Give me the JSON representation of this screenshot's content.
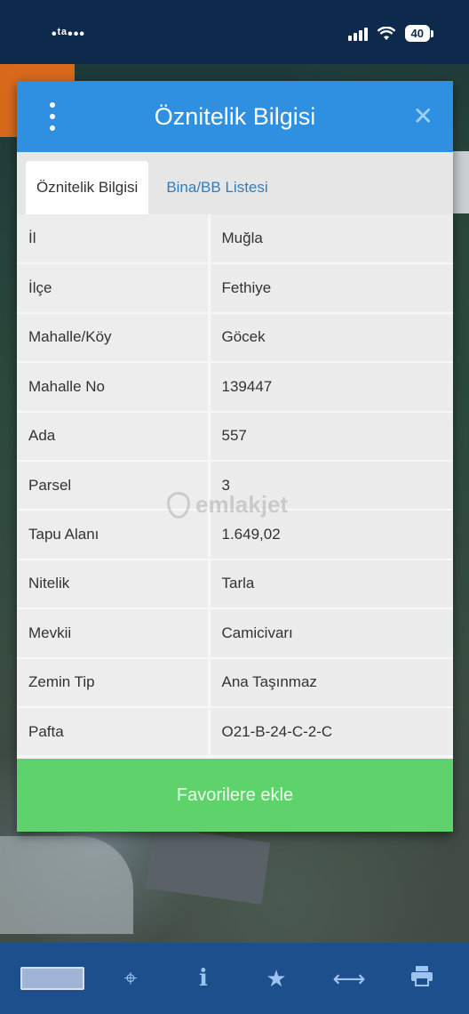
{
  "status_bar": {
    "time": "•ᵗᵃ•••",
    "battery": "40"
  },
  "dialog": {
    "title": "Öznitelik Bilgisi",
    "tabs": [
      {
        "label": "Öznitelik Bilgisi",
        "active": true
      },
      {
        "label": "Bina/BB Listesi",
        "active": false
      }
    ],
    "rows": [
      {
        "label": "İl",
        "value": "Muğla"
      },
      {
        "label": "İlçe",
        "value": "Fethiye"
      },
      {
        "label": "Mahalle/Köy",
        "value": "Göcek"
      },
      {
        "label": "Mahalle No",
        "value": "139447"
      },
      {
        "label": "Ada",
        "value": "557"
      },
      {
        "label": "Parsel",
        "value": "3"
      },
      {
        "label": "Tapu Alanı",
        "value": "1.649,02"
      },
      {
        "label": "Nitelik",
        "value": "Tarla"
      },
      {
        "label": "Mevkii",
        "value": "Camicivarı"
      },
      {
        "label": "Zemin Tip",
        "value": "Ana Taşınmaz"
      },
      {
        "label": "Pafta",
        "value": "O21-B-24-C-2-C"
      }
    ],
    "favorite_button": "Favorilere ekle"
  },
  "watermark": "emlakjet",
  "toolbar": {
    "items": [
      "logo",
      "locate-icon",
      "info-icon",
      "star-icon",
      "measure-icon",
      "print-icon"
    ]
  },
  "colors": {
    "header": "#2f8fe0",
    "button": "#5fd36b",
    "toolbar": "#1d4f8c"
  }
}
